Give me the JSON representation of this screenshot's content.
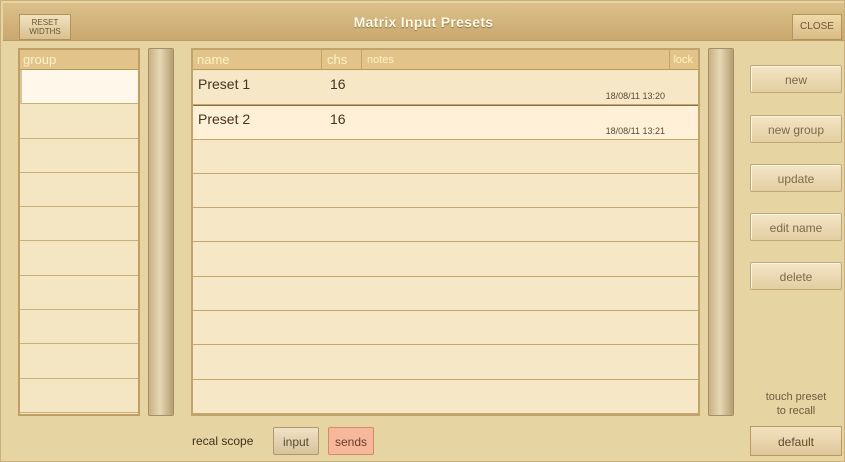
{
  "window": {
    "title": "Matrix Input Presets",
    "reset_widths": "RESET WIDTHS",
    "close": "CLOSE"
  },
  "group_list": {
    "header": "group"
  },
  "preset_table": {
    "headers": {
      "name": "name",
      "chs": "chs",
      "notes": "notes",
      "lock": "lock"
    },
    "rows": [
      {
        "name": "Preset 1",
        "chs": "16",
        "date": "18/08/11 13:20"
      },
      {
        "name": "Preset 2",
        "chs": "16",
        "date": "18/08/11 13:21"
      }
    ]
  },
  "actions": {
    "new": "new",
    "new_group": "new group",
    "update": "update",
    "edit_name": "edit name",
    "delete": "delete",
    "touch_preset": "touch preset\nto recall",
    "default": "default"
  },
  "recall_scope": {
    "label": "recal scope",
    "input": "input",
    "sends": "sends",
    "selected": "sends"
  },
  "colors": {
    "title_bar": "#cfae73",
    "panel": "#e6d4a2",
    "selected_scope": "#f6b79b"
  }
}
